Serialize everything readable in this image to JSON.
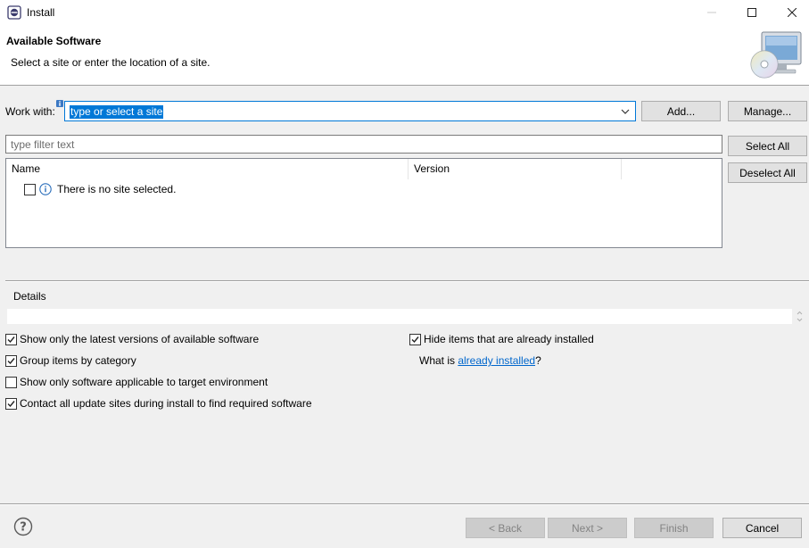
{
  "window": {
    "title": "Install",
    "app_icon": "eclipse-icon"
  },
  "header": {
    "title": "Available Software",
    "description": "Select a site or enter the location of a site.",
    "image": "software-cd-monitor-icon"
  },
  "work_with": {
    "label": "Work with:",
    "value": "type or select a site",
    "add_label": "Add...",
    "manage_label": "Manage..."
  },
  "filter": {
    "placeholder": "type filter text"
  },
  "selection": {
    "select_all_label": "Select All",
    "deselect_all_label": "Deselect All"
  },
  "tree": {
    "columns": [
      "Name",
      "Version"
    ],
    "empty_message": "There is no site selected."
  },
  "details": {
    "label": "Details"
  },
  "options": {
    "show_latest": {
      "label": "Show only the latest versions of available software",
      "checked": true
    },
    "group_by_category": {
      "label": "Group items by category",
      "checked": true
    },
    "show_applicable": {
      "label": "Show only software applicable to target environment",
      "checked": false
    },
    "contact_sites": {
      "label": "Contact all update sites during install to find required software",
      "checked": true
    },
    "hide_installed": {
      "label": "Hide items that are already installed",
      "checked": true
    },
    "what_is_prefix": "What is ",
    "already_installed_link": "already installed",
    "what_is_suffix": "?"
  },
  "footer": {
    "back_label": "< Back",
    "next_label": "Next >",
    "finish_label": "Finish",
    "cancel_label": "Cancel"
  },
  "colors": {
    "accent": "#0078d7",
    "link": "#0066cc",
    "dialog_bg": "#f0f0f0"
  }
}
